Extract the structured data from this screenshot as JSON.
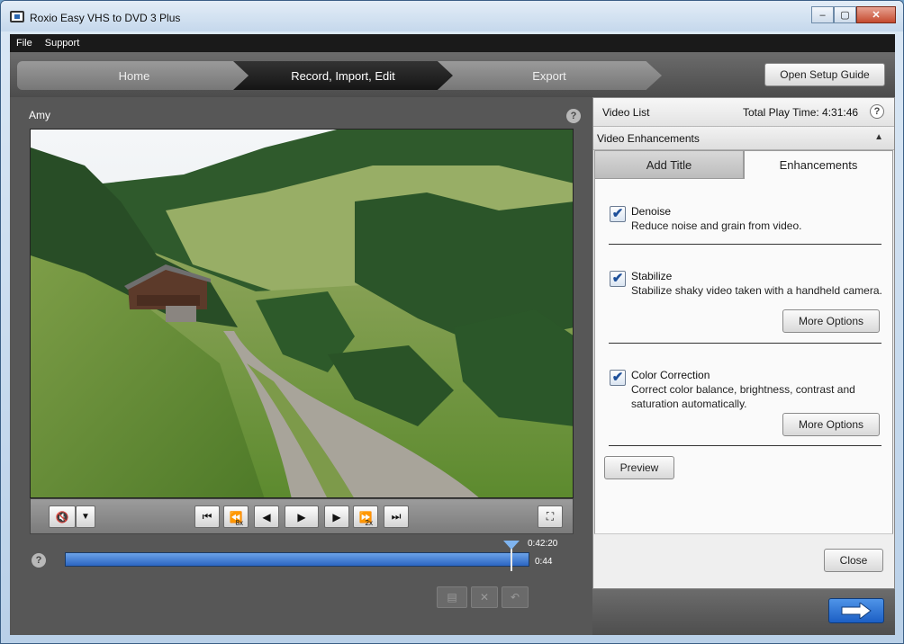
{
  "window": {
    "title": "Roxio Easy VHS to DVD 3 Plus",
    "controls": [
      "–",
      "▢",
      "✕"
    ]
  },
  "menu": [
    "File",
    "Support"
  ],
  "nav": {
    "steps": [
      "Home",
      "Record, Import, Edit",
      "Export"
    ],
    "setup_label": "Open Setup Guide"
  },
  "video": {
    "name": "Amy",
    "help": "?",
    "time_total": "0:42:20",
    "time_current": "0:44",
    "progress": 0.97
  },
  "player_controls": {
    "mute_icon": "speaker-muted-icon",
    "mute": "🔇",
    "dropdown": "▼",
    "skip_start": "⏮",
    "rewind": "⏪",
    "rewind_speed": "8x",
    "step_back": "◀",
    "play": "▶",
    "step_forward": "▶",
    "fast_forward": "⏩",
    "ff_speed": "2x",
    "skip_end": "⏭",
    "fullscreen": "⛶"
  },
  "bottom_tools": {
    "film": "▤",
    "delete": "✕",
    "undo": "↶"
  },
  "right_panel": {
    "video_list_label": "Video List",
    "total_time_label": "Total Play Time: 4:31:46",
    "help": "?",
    "section_title": "Video Enhancements",
    "collapse": "▲",
    "tabs": [
      "Add Title",
      "Enhancements"
    ],
    "options": [
      {
        "title": "Denoise",
        "desc": "Reduce noise and grain from video.",
        "checked": true
      },
      {
        "title": "Stabilize",
        "desc": "Stabilize shaky video taken with a handheld camera.",
        "checked": true
      },
      {
        "title": "Color Correction",
        "desc": "Correct color balance, brightness, contrast and saturation automatically.",
        "checked": true
      }
    ],
    "more_options_label": "More Options",
    "preview_label": "Preview",
    "close_label": "Close",
    "check_mark": "✔"
  },
  "next_arrow": "➡"
}
